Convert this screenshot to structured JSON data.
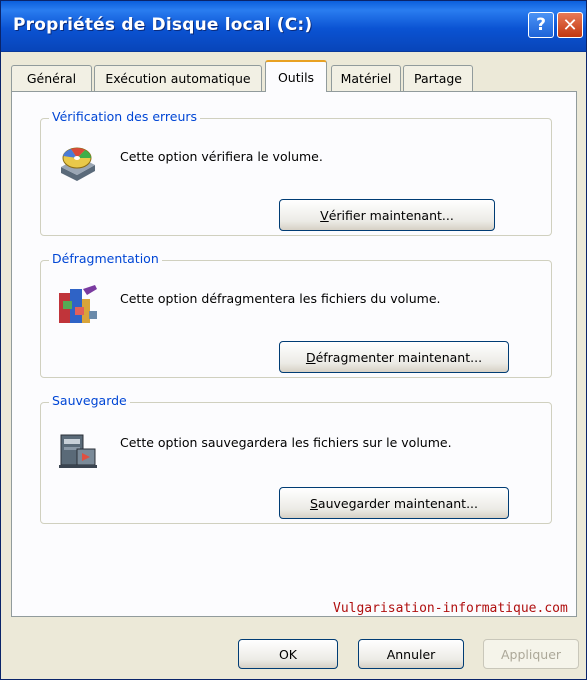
{
  "window": {
    "title": "Propriétés de Disque local (C:)",
    "help_glyph": "?",
    "close_glyph": "✕"
  },
  "tabs": [
    {
      "label": "Général",
      "active": false
    },
    {
      "label": "Exécution automatique",
      "active": false
    },
    {
      "label": "Outils",
      "active": true
    },
    {
      "label": "Matériel",
      "active": false
    },
    {
      "label": "Partage",
      "active": false
    }
  ],
  "groups": {
    "verification": {
      "title": "Vérification des erreurs",
      "description": "Cette option vérifiera le volume.",
      "button": {
        "mnemonic": "V",
        "rest": "érifier maintenant..."
      },
      "icon": "check-disk-icon"
    },
    "defrag": {
      "title": "Défragmentation",
      "description": "Cette option défragmentera les fichiers du volume.",
      "button": {
        "mnemonic": "D",
        "rest": "éfragmenter maintenant..."
      },
      "icon": "defragment-icon"
    },
    "backup": {
      "title": "Sauvegarde",
      "description": "Cette option sauvegardera les fichiers sur le volume.",
      "button": {
        "mnemonic": "S",
        "rest": "auvegarder maintenant..."
      },
      "icon": "backup-icon"
    }
  },
  "watermark": "Vulgarisation-informatique.com",
  "footer": {
    "ok": "OK",
    "cancel": "Annuler",
    "apply": "Appliquer"
  },
  "colors": {
    "titlebar": "#0b53d3",
    "group_title": "#0046d5",
    "active_tab_accent": "#e8a123",
    "watermark": "#b01010"
  }
}
